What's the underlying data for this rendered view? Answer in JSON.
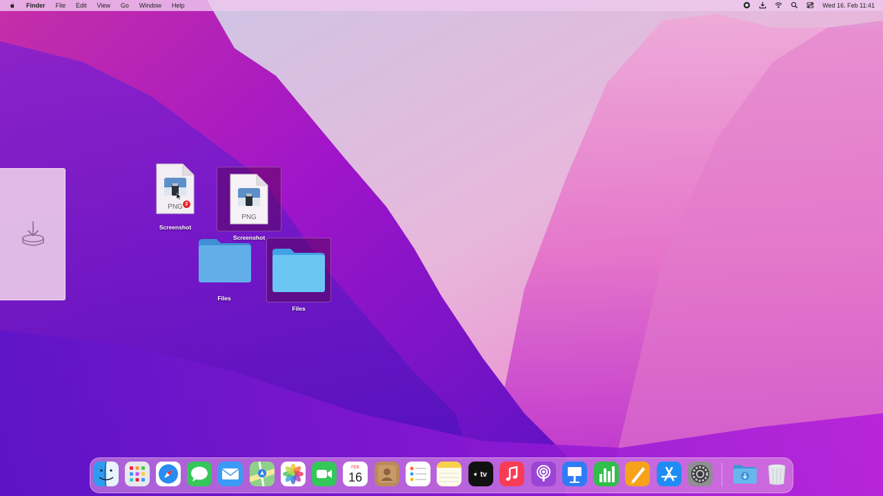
{
  "menubar": {
    "app_name": "Finder",
    "menus": [
      "File",
      "Edit",
      "View",
      "Go",
      "Window",
      "Help"
    ],
    "clock": "Wed 16. Feb  11:41",
    "status_icons": [
      "screen-record-icon",
      "download-icon",
      "wifi-icon",
      "search-icon",
      "control-center-icon"
    ]
  },
  "desktop": {
    "items": [
      {
        "label": "Screenshot",
        "type_label": "PNG",
        "badge": "2"
      },
      {
        "label": "Screenshot",
        "type_label": "PNG"
      },
      {
        "label": "Files"
      },
      {
        "label": "Files"
      }
    ]
  },
  "dock": {
    "calendar": {
      "month": "FEB",
      "day": "16"
    },
    "apps": [
      "finder",
      "launchpad",
      "safari",
      "messages",
      "mail",
      "maps",
      "photos",
      "facetime",
      "calendar",
      "contacts",
      "reminders",
      "notes",
      "apple-tv",
      "music",
      "podcasts",
      "keynote",
      "numbers",
      "pages",
      "app-store",
      "system-preferences",
      "downloads",
      "trash"
    ]
  },
  "colors": {
    "accent": "#b81ad6",
    "badge": "#e5252a"
  }
}
